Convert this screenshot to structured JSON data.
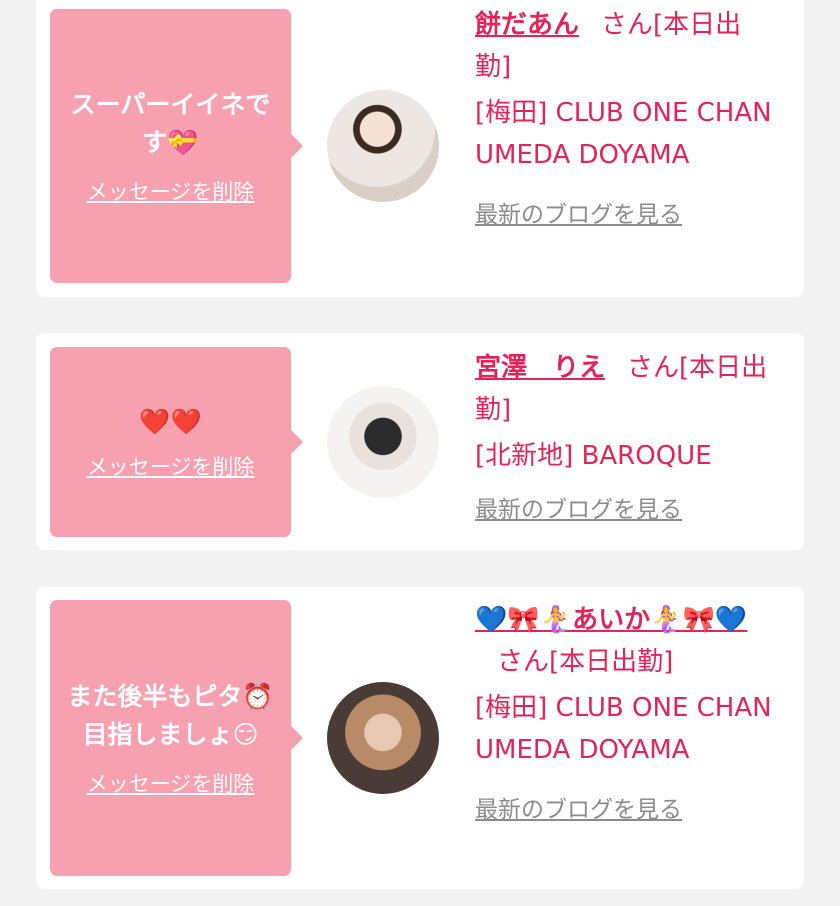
{
  "cards": [
    {
      "message_lines": [
        "スーパーイイネで",
        "す💝"
      ],
      "delete_label": "メッセージを削除",
      "name": "餅だあん",
      "suffix": "さん[本日出勤]",
      "shop": "[梅田] CLUB ONE CHAN UMEDA DOYAMA",
      "blog_label": "最新のブログを見る"
    },
    {
      "message_lines": [
        "❤️❤️"
      ],
      "delete_label": "メッセージを削除",
      "name": "宮澤　りえ",
      "suffix": "さん[本日出勤]",
      "shop": "[北新地] BAROQUE",
      "blog_label": "最新のブログを見る"
    },
    {
      "message_lines": [
        "また後半もピタ⏰",
        "目指しましょ😏"
      ],
      "delete_label": "メッセージを削除",
      "name": "💙🎀🧜‍♀️あいか🧜‍♀️🎀💙",
      "suffix": "さん[本日出勤]",
      "shop": "[梅田] CLUB ONE CHAN UMEDA DOYAMA",
      "blog_label": "最新のブログを見る"
    }
  ],
  "colors": {
    "page_bg": "#f2f2f2",
    "bubble": "#f7a0b0",
    "accent": "#e3245b",
    "link_gray": "#8c8c8c"
  }
}
